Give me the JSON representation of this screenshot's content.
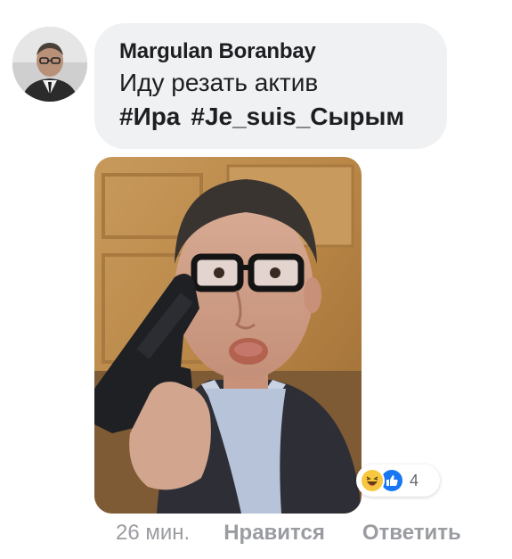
{
  "comment": {
    "author": "Margulan Boranbay",
    "text": "Иду резать актив",
    "hashtags": [
      "#Ира",
      "#Je_suis_Сырым"
    ]
  },
  "reactions": {
    "icons": [
      "haha-icon",
      "like-icon"
    ],
    "count": "4"
  },
  "actions": {
    "time": "26 мин.",
    "like_label": "Нравится",
    "reply_label": "Ответить"
  },
  "colors": {
    "bubble": "#f0f1f3",
    "text": "#1c1e21",
    "meta": "#9a9ca1",
    "like_blue": "#1877f2",
    "haha_yellow": "#f7c83f"
  }
}
